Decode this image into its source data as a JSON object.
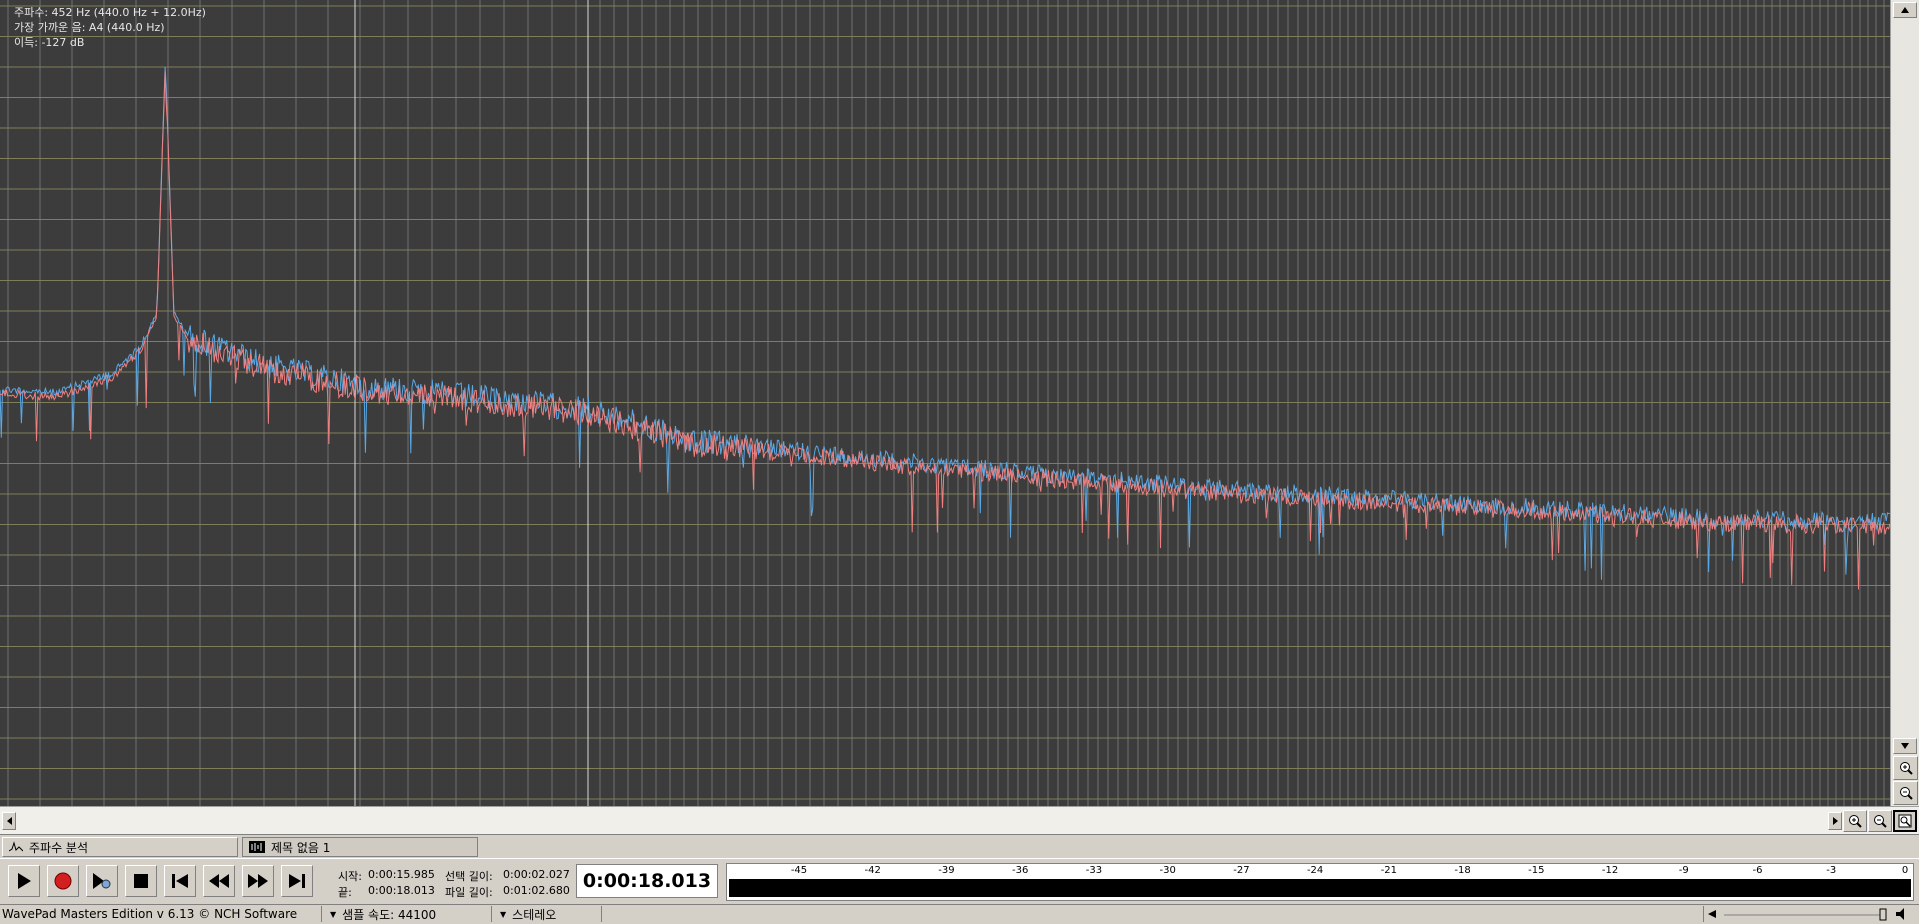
{
  "app": {
    "title": "WavePad Masters Edition v 6.13 © NCH Software"
  },
  "readout": {
    "frequency": "주파수: 452 Hz (440.0 Hz + 12.0Hz)",
    "nearest_note": "가장 가까운 음: A4 (440.0 Hz)",
    "gain": "이득: -127 dB"
  },
  "plot_colors": {
    "background": "#3c3c3c",
    "grid_h": "#9c9a66",
    "grid_v": "#7c7c7c",
    "grid_v_major": "#d8d8d8",
    "series_left": "#5aa9e6",
    "series_right": "#f08080"
  },
  "spectrum_series": {
    "peak_x_fraction": 0.0875,
    "envelope": [
      [
        0.0,
        0.485
      ],
      [
        0.03,
        0.49
      ],
      [
        0.06,
        0.465
      ],
      [
        0.075,
        0.43
      ],
      [
        0.083,
        0.39
      ],
      [
        0.0875,
        0.075
      ],
      [
        0.092,
        0.39
      ],
      [
        0.1,
        0.42
      ],
      [
        0.14,
        0.455
      ],
      [
        0.19,
        0.48
      ],
      [
        0.31,
        0.51
      ],
      [
        0.37,
        0.55
      ],
      [
        0.5,
        0.58
      ],
      [
        0.65,
        0.61
      ],
      [
        0.8,
        0.63
      ],
      [
        0.9,
        0.645
      ],
      [
        1.0,
        0.65
      ]
    ]
  },
  "tabs": [
    {
      "label": "주파수 분석",
      "active": true
    },
    {
      "label": "제목 없음 1",
      "active": false
    }
  ],
  "transport": {
    "buttons": [
      "play-icon",
      "record-icon",
      "scrub-icon",
      "stop-icon",
      "skip-start-icon",
      "rewind-icon",
      "fast-forward-icon",
      "skip-end-icon"
    ],
    "start_label": "시작:",
    "start_value": "0:00:15.985",
    "end_label": "끝:",
    "end_value": "0:00:18.013",
    "sel_len_label": "선택 길이:",
    "sel_len_value": "0:00:02.027",
    "file_len_label": "파일 길이:",
    "file_len_value": "0:01:02.680",
    "current_time": "0:00:18.013"
  },
  "level_meter": {
    "ticks": [
      "-45",
      "-42",
      "-39",
      "-36",
      "-33",
      "-30",
      "-27",
      "-24",
      "-21",
      "-18",
      "-15",
      "-12",
      "-9",
      "-6",
      "-3",
      "0"
    ]
  },
  "status": {
    "sample_rate": "샘플 속도: 44100",
    "channels": "스테레오"
  }
}
